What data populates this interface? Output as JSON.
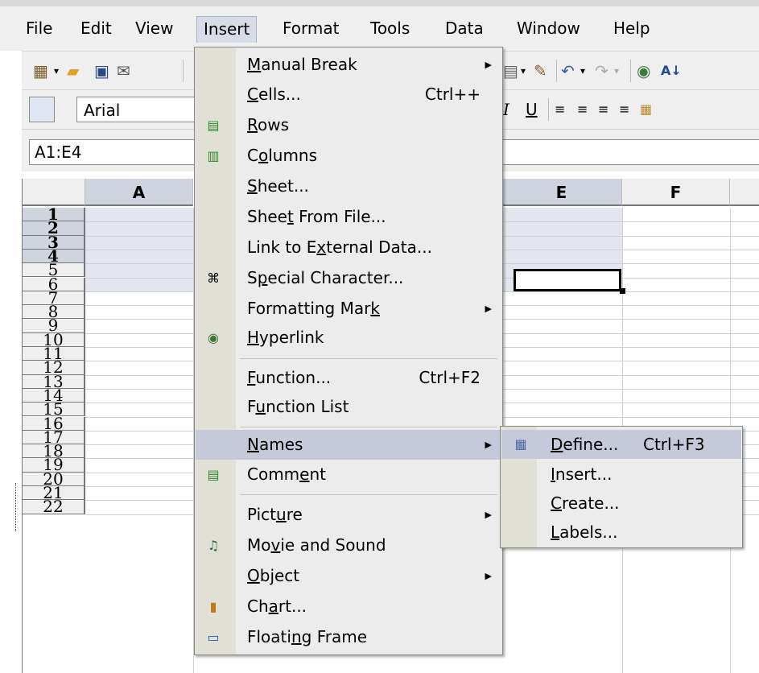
{
  "menubar": {
    "items": [
      "File",
      "Edit",
      "View",
      "Insert",
      "Format",
      "Tools",
      "Data",
      "Window",
      "Help"
    ],
    "active": "Insert"
  },
  "formatting": {
    "font_name": "Arial"
  },
  "formula_bar": {
    "name_box": "A1:E4"
  },
  "sheet": {
    "columns": [
      "A",
      "E",
      "F"
    ],
    "rows": [
      "1",
      "2",
      "3",
      "4",
      "5",
      "6",
      "7",
      "8",
      "9",
      "10",
      "11",
      "12",
      "13",
      "14",
      "15",
      "16",
      "17",
      "18",
      "19",
      "20",
      "21",
      "22"
    ]
  },
  "insert_menu": {
    "items": [
      {
        "label": "Manual Break",
        "submenu": true,
        "icon": ""
      },
      {
        "label": "Cells...",
        "shortcut": "Ctrl++",
        "icon": ""
      },
      {
        "label": "Rows",
        "icon": "insert-rows-icon"
      },
      {
        "label": "Columns",
        "icon": "insert-columns-icon"
      },
      {
        "label": "Sheet...",
        "icon": ""
      },
      {
        "label": "Sheet From File...",
        "icon": ""
      },
      {
        "label": "Link to External Data...",
        "icon": ""
      },
      {
        "label": "Special Character...",
        "icon": "special-character-icon"
      },
      {
        "label": "Formatting Mark",
        "submenu": true,
        "icon": ""
      },
      {
        "label": "Hyperlink",
        "icon": "hyperlink-icon"
      },
      {
        "label": "Function...",
        "shortcut": "Ctrl+F2",
        "icon": ""
      },
      {
        "label": "Function List",
        "icon": ""
      },
      {
        "label": "Names",
        "submenu": true,
        "highlighted": true,
        "icon": ""
      },
      {
        "label": "Comment",
        "icon": "comment-icon"
      },
      {
        "label": "Picture",
        "submenu": true,
        "icon": ""
      },
      {
        "label": "Movie and Sound",
        "icon": "movie-sound-icon"
      },
      {
        "label": "Object",
        "submenu": true,
        "icon": ""
      },
      {
        "label": "Chart...",
        "icon": "chart-icon"
      },
      {
        "label": "Floating Frame",
        "icon": "floating-frame-icon"
      }
    ]
  },
  "names_submenu": {
    "items": [
      {
        "label": "Define...",
        "shortcut": "Ctrl+F3",
        "highlighted": true,
        "icon": "define-names-icon"
      },
      {
        "label": "Insert..."
      },
      {
        "label": "Create..."
      },
      {
        "label": "Labels..."
      }
    ]
  },
  "colors": {
    "highlight": "#c5c9da",
    "menu_bg": "#ececec",
    "selection": "#e3e6ee"
  }
}
